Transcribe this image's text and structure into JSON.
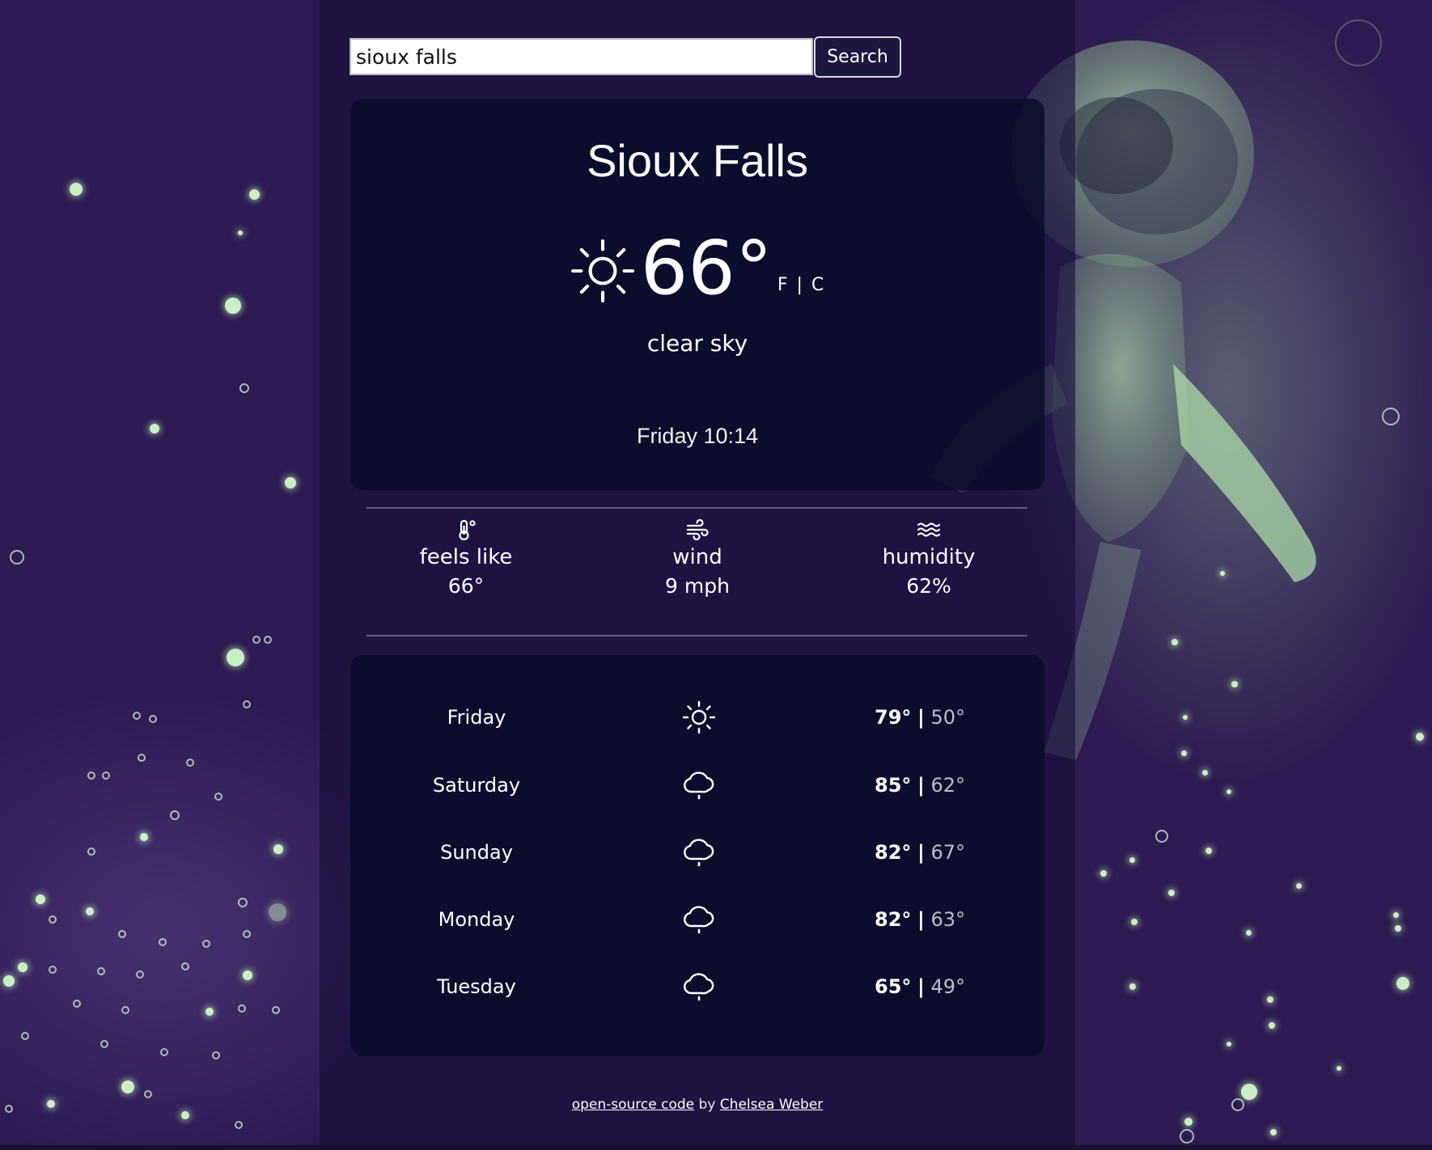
{
  "search": {
    "value": "sioux falls",
    "button_label": "Search"
  },
  "current": {
    "city": "Sioux Falls",
    "temperature": "66°",
    "unit_f": "F",
    "unit_separator": "|",
    "unit_c": "C",
    "condition": "clear sky",
    "datetime": "Friday 10:14",
    "icon": "sun-icon"
  },
  "stats": [
    {
      "icon": "thermometer-icon",
      "label": "feels like",
      "value": "66°"
    },
    {
      "icon": "wind-icon",
      "label": "wind",
      "value": "9 mph"
    },
    {
      "icon": "humidity-icon",
      "label": "humidity",
      "value": "62%"
    }
  ],
  "forecast": [
    {
      "day": "Friday",
      "icon": "sun-icon",
      "high": "79°",
      "separator": "|",
      "low": "50°"
    },
    {
      "day": "Saturday",
      "icon": "cloud-rain-icon",
      "high": "85°",
      "separator": "|",
      "low": "62°"
    },
    {
      "day": "Sunday",
      "icon": "cloud-rain-icon",
      "high": "82°",
      "separator": "|",
      "low": "67°"
    },
    {
      "day": "Monday",
      "icon": "cloud-rain-icon",
      "high": "82°",
      "separator": "|",
      "low": "63°"
    },
    {
      "day": "Tuesday",
      "icon": "cloud-rain-icon",
      "high": "65°",
      "separator": "|",
      "low": "49°"
    }
  ],
  "footer": {
    "code_link": "open-source code",
    "by": " by ",
    "author_link": "Chelsea Weber"
  },
  "colors": {
    "background": "#2d1a52",
    "card": "#090c28",
    "accent_glow": "#c9f0c4"
  }
}
